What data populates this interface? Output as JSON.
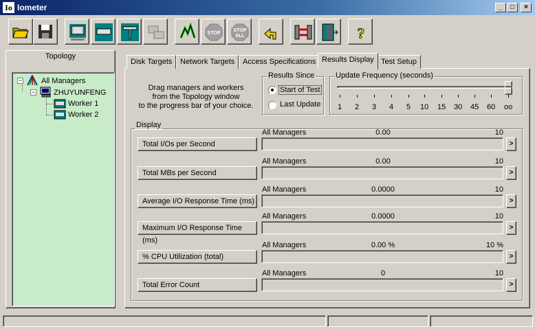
{
  "window": {
    "title": "Iometer",
    "icon_text": "Io"
  },
  "toolbar": {
    "buttons": [
      "open-icon",
      "save-icon",
      "display-icon",
      "network-icon",
      "worker-icon",
      "copy-worker-icon",
      "start-icon",
      "stop-icon",
      "stop-all-icon",
      "reset-icon",
      "disconnect-icon",
      "exit-icon",
      "help-icon"
    ]
  },
  "topology": {
    "title": "Topology",
    "root": "All Managers",
    "manager": "ZHUYUNFENG",
    "workers": [
      "Worker 1",
      "Worker 2"
    ]
  },
  "tabs": [
    "Disk Targets",
    "Network Targets",
    "Access Specifications",
    "Results Display",
    "Test Setup"
  ],
  "results": {
    "instructions": [
      "Drag managers and workers",
      "from the Topology window",
      "to the progress bar of your choice."
    ],
    "results_since": {
      "label": "Results Since",
      "options": [
        "Start of Test",
        "Last Update"
      ],
      "selected": "Start of Test"
    },
    "update_frequency": {
      "label": "Update Frequency (seconds)",
      "ticks": [
        "1",
        "2",
        "3",
        "4",
        "5",
        "10",
        "15",
        "30",
        "45",
        "60",
        "oo"
      ],
      "selected": "oo"
    },
    "display_label": "Display",
    "metrics": [
      {
        "button": "Total I/Os per Second",
        "source": "All Managers",
        "value": "0.00",
        "max": "10",
        "fill": 0
      },
      {
        "button": "Total MBs per Second",
        "source": "All Managers",
        "value": "0.00",
        "max": "10",
        "fill": 0
      },
      {
        "button": "Average I/O Response Time (ms)",
        "source": "All Managers",
        "value": "0.0000",
        "max": "10",
        "fill": 0
      },
      {
        "button": "Maximum I/O Response Time (ms)",
        "source": "All Managers",
        "value": "0.0000",
        "max": "10",
        "fill": 0
      },
      {
        "button": "% CPU Utilization (total)",
        "source": "All Managers",
        "value": "0.00 %",
        "max": "10 %",
        "fill": 0
      },
      {
        "button": "Total Error Count",
        "source": "All Managers",
        "value": "0",
        "max": "10",
        "fill": 0
      }
    ],
    "arrow": ">"
  },
  "window_buttons": {
    "minimize": "_",
    "maximize": "□",
    "close": "×"
  }
}
